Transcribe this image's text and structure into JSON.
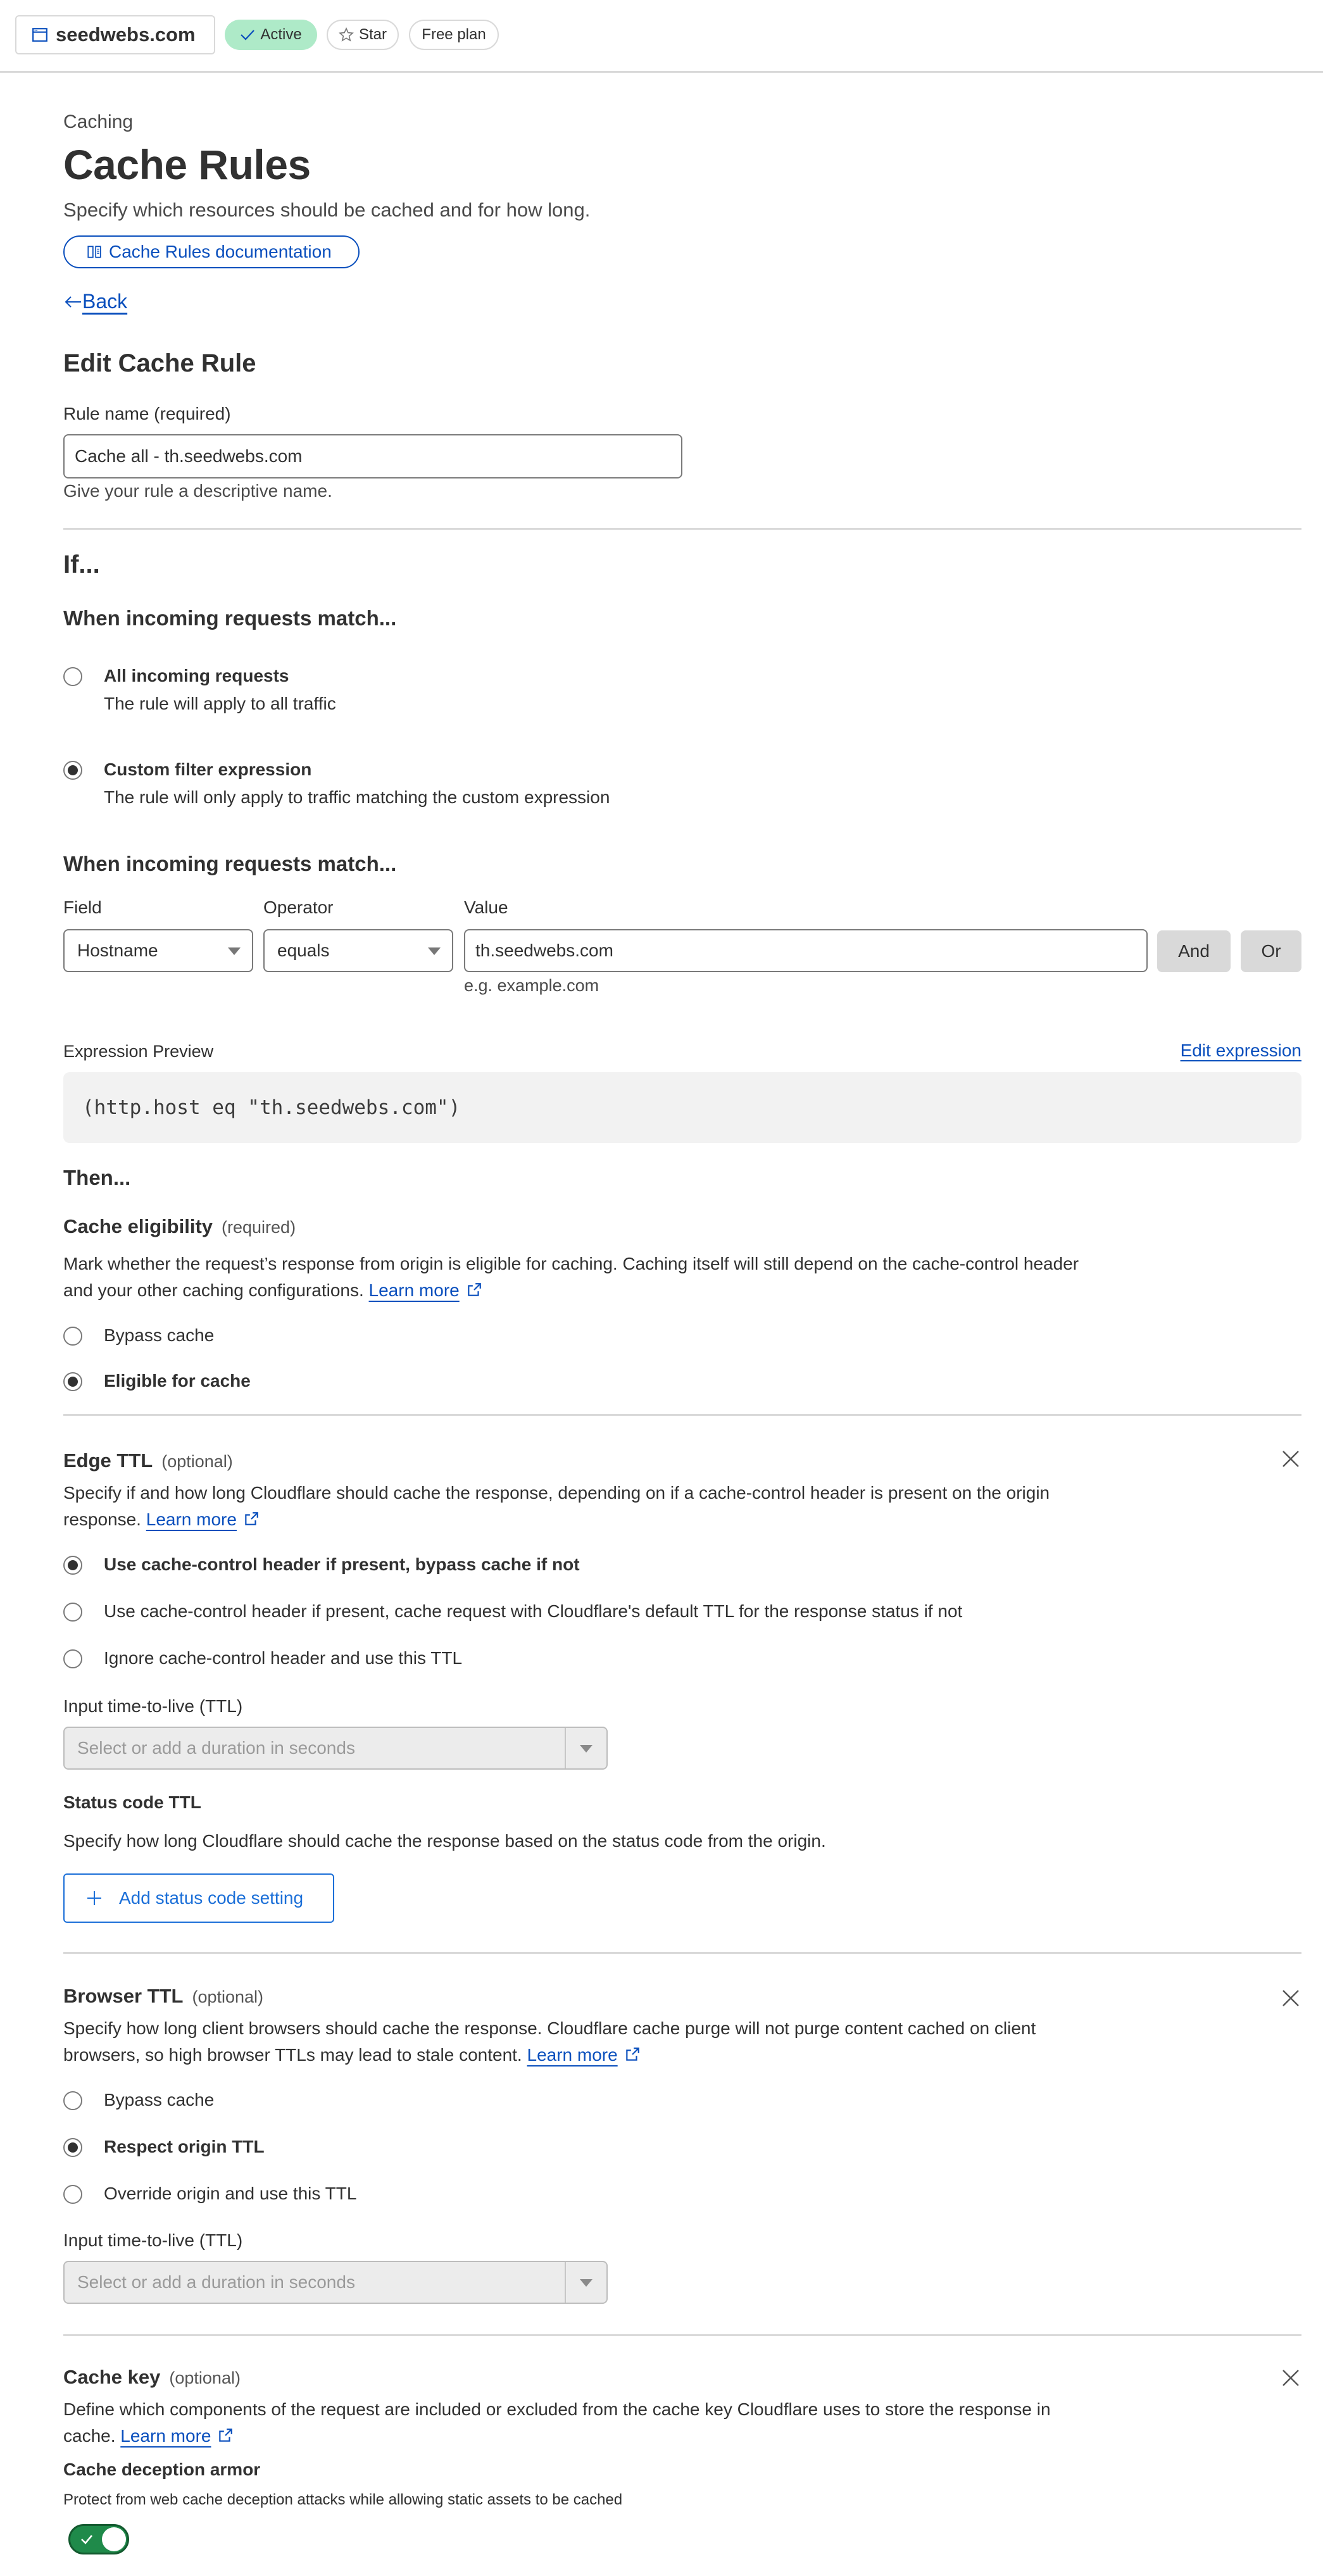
{
  "topbar": {
    "zone_name": "seedwebs.com",
    "status_label": "Active",
    "star_label": "Star",
    "plan_label": "Free plan",
    "icons": {
      "zone": "browser-window-icon",
      "status": "check-icon",
      "star": "star-icon"
    }
  },
  "header": {
    "eyebrow": "Caching",
    "title": "Cache Rules",
    "subtitle": "Specify which resources should be cached and for how long.",
    "doc_button": "Cache Rules documentation",
    "back_label": "Back"
  },
  "rule": {
    "heading": "Edit Cache Rule",
    "name_label": "Rule name (required)",
    "name_value": "Cache all - th.seedwebs.com",
    "name_help": "Give your rule a descriptive name."
  },
  "if_section": {
    "heading": "If...",
    "match_heading": "When incoming requests match...",
    "options": [
      {
        "title": "All incoming requests",
        "desc": "The rule will apply to all traffic",
        "checked": false
      },
      {
        "title": "Custom filter expression",
        "desc": "The rule will only apply to traffic matching the custom expression",
        "checked": true
      }
    ],
    "builder_heading": "When incoming requests match...",
    "field_label": "Field",
    "field_value": "Hostname",
    "operator_label": "Operator",
    "operator_value": "equals",
    "value_label": "Value",
    "value_value": "th.seedwebs.com",
    "value_help": "e.g. example.com",
    "and_label": "And",
    "or_label": "Or",
    "preview_label": "Expression Preview",
    "edit_expression": "Edit expression",
    "expression": "(http.host eq \"th.seedwebs.com\")"
  },
  "then_section": {
    "heading": "Then...",
    "eligibility": {
      "title": "Cache eligibility",
      "tag": "(required)",
      "desc": "Mark whether the request’s response from origin is eligible for caching. Caching itself will still depend on the cache-control header and your other caching configurations.",
      "learn_more": "Learn more",
      "options": [
        {
          "label": "Bypass cache",
          "checked": false
        },
        {
          "label": "Eligible for cache",
          "checked": true
        }
      ]
    },
    "edge_ttl": {
      "title": "Edge TTL",
      "tag": "(optional)",
      "desc": "Specify if and how long Cloudflare should cache the response, depending on if a cache-control header is present on the origin response.",
      "learn_more": "Learn more",
      "options": [
        {
          "label": "Use cache-control header if present, bypass cache if not",
          "checked": true
        },
        {
          "label": "Use cache-control header if present, cache request with Cloudflare's default TTL for the response status if not",
          "checked": false
        },
        {
          "label": "Ignore cache-control header and use this TTL",
          "checked": false
        }
      ],
      "ttl_label": "Input time-to-live (TTL)",
      "ttl_placeholder": "Select or add a duration in seconds",
      "status_title": "Status code TTL",
      "status_desc": "Specify how long Cloudflare should cache the response based on the status code from the origin.",
      "add_status_button": "Add status code setting"
    },
    "browser_ttl": {
      "title": "Browser TTL",
      "tag": "(optional)",
      "desc": "Specify how long client browsers should cache the response. Cloudflare cache purge will not purge content cached on client browsers, so high browser TTLs may lead to stale content.",
      "learn_more": "Learn more",
      "options": [
        {
          "label": "Bypass cache",
          "checked": false
        },
        {
          "label": "Respect origin TTL",
          "checked": true
        },
        {
          "label": "Override origin and use this TTL",
          "checked": false
        }
      ],
      "ttl_label": "Input time-to-live (TTL)",
      "ttl_placeholder": "Select or add a duration in seconds"
    },
    "cache_key": {
      "title": "Cache key",
      "tag": "(optional)",
      "desc": "Define which components of the request are included or excluded from the cache key Cloudflare uses to store the response in cache.",
      "learn_more": "Learn more",
      "armor_title": "Cache deception armor",
      "armor_desc": "Protect from web cache deception attacks while allowing static assets to be cached",
      "armor_enabled": true
    }
  },
  "colors": {
    "link": "#0a4fbd",
    "active_badge": "#aeeac8",
    "toggle_on": "#1f8a4a",
    "code_bg": "#f2f2f2"
  }
}
